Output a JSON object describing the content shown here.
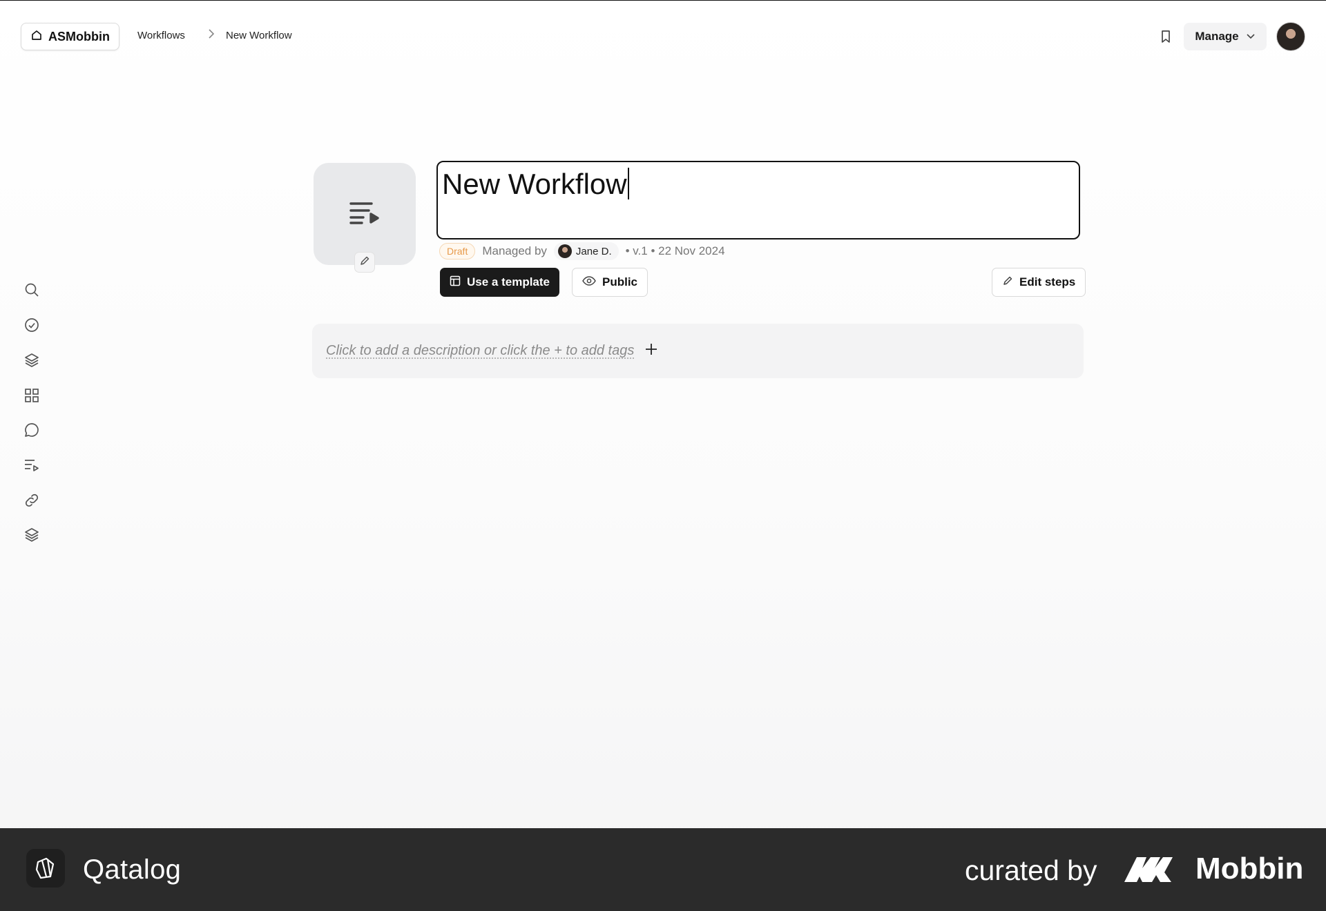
{
  "header": {
    "workspace_label": "ASMobbin",
    "breadcrumbs": [
      "Workflows",
      "New Workflow"
    ],
    "breadcrumb_separator": ">",
    "manage_label": "Manage",
    "icons": [
      "home-icon",
      "chevron-right-icon",
      "bookmark-icon",
      "chevron-down-icon"
    ]
  },
  "sidebar": {
    "icons": [
      "search-icon",
      "check-circle-icon",
      "layers-icon",
      "grid-icon",
      "chat-bubble-icon",
      "playlist-icon",
      "link-icon",
      "layers-icon"
    ]
  },
  "workflow": {
    "title": "New Workflow",
    "status": "Draft",
    "managed_by_label": "Managed by",
    "owner": "Jane D.",
    "version_date": "• v.1 • 22 Nov 2024",
    "use_template_label": "Use a template",
    "visibility_label": "Public",
    "edit_steps_label": "Edit steps",
    "description_placeholder": "Click to add a description or click the + to add tags",
    "add_symbol": "+"
  },
  "footer": {
    "brand": "Qatalog",
    "curated_by": "curated by",
    "curator": "Mobbin"
  },
  "colors": {
    "accent_dark": "#1b1b1b",
    "draft_badge": "#e79a4b",
    "footer_bg": "#2b2b2b"
  }
}
